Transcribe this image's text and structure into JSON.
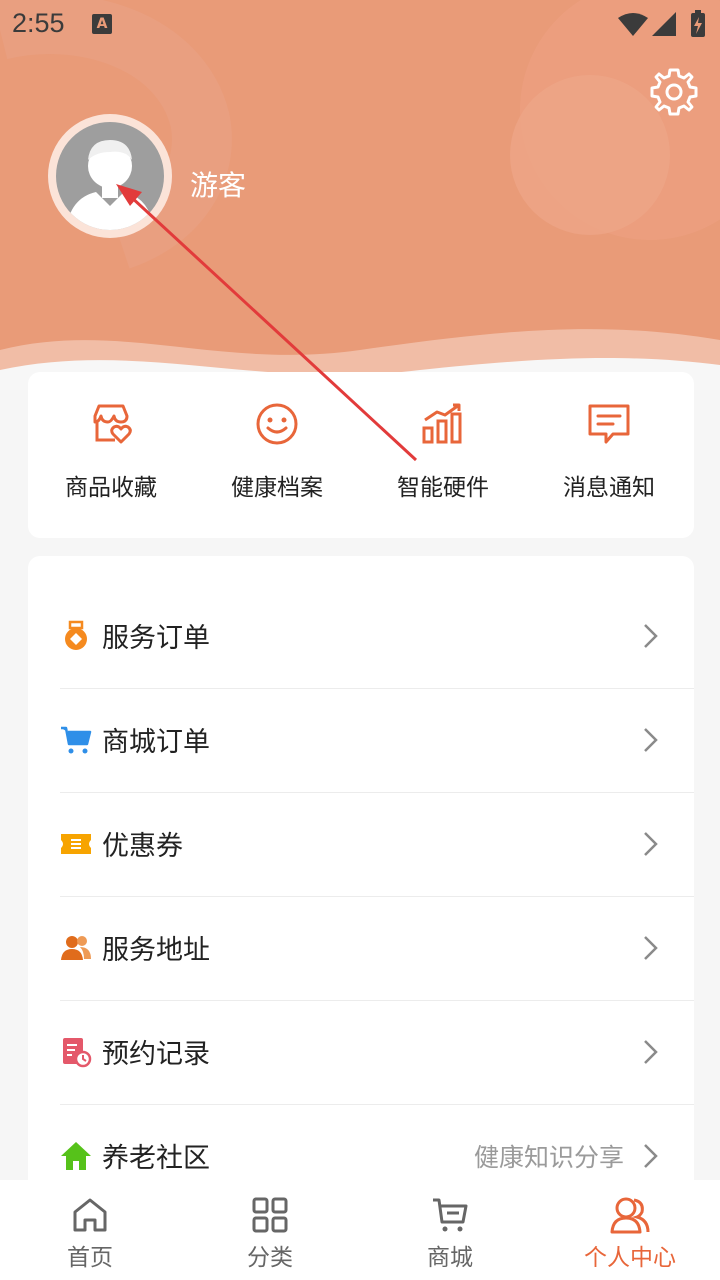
{
  "status": {
    "time": "2:55",
    "badge": "A"
  },
  "profile": {
    "username": "游客"
  },
  "quick": [
    {
      "label": "商品收藏",
      "icon": "shop-heart-icon"
    },
    {
      "label": "健康档案",
      "icon": "smile-icon"
    },
    {
      "label": "智能硬件",
      "icon": "bar-chart-icon"
    },
    {
      "label": "消息通知",
      "icon": "message-icon"
    }
  ],
  "menu": [
    {
      "label": "服务订单",
      "icon": "medal-icon",
      "color": "#f58a1f"
    },
    {
      "label": "商城订单",
      "icon": "cart-icon",
      "color": "#2f8fe8"
    },
    {
      "label": "优惠券",
      "icon": "coupon-icon",
      "color": "#f7a400"
    },
    {
      "label": "服务地址",
      "icon": "people-icon",
      "color": "#e06c1c"
    },
    {
      "label": "预约记录",
      "icon": "record-icon",
      "color": "#e4586a"
    },
    {
      "label": "养老社区",
      "icon": "home-icon",
      "color": "#56c21a",
      "extra": "健康知识分享"
    }
  ],
  "tabs": [
    {
      "label": "首页",
      "icon": "home-outline-icon"
    },
    {
      "label": "分类",
      "icon": "grid-icon"
    },
    {
      "label": "商城",
      "icon": "cart-outline-icon"
    },
    {
      "label": "个人中心",
      "icon": "users-icon",
      "active": true
    }
  ],
  "colors": {
    "accent": "#e8663a",
    "header": "#e99b78"
  }
}
